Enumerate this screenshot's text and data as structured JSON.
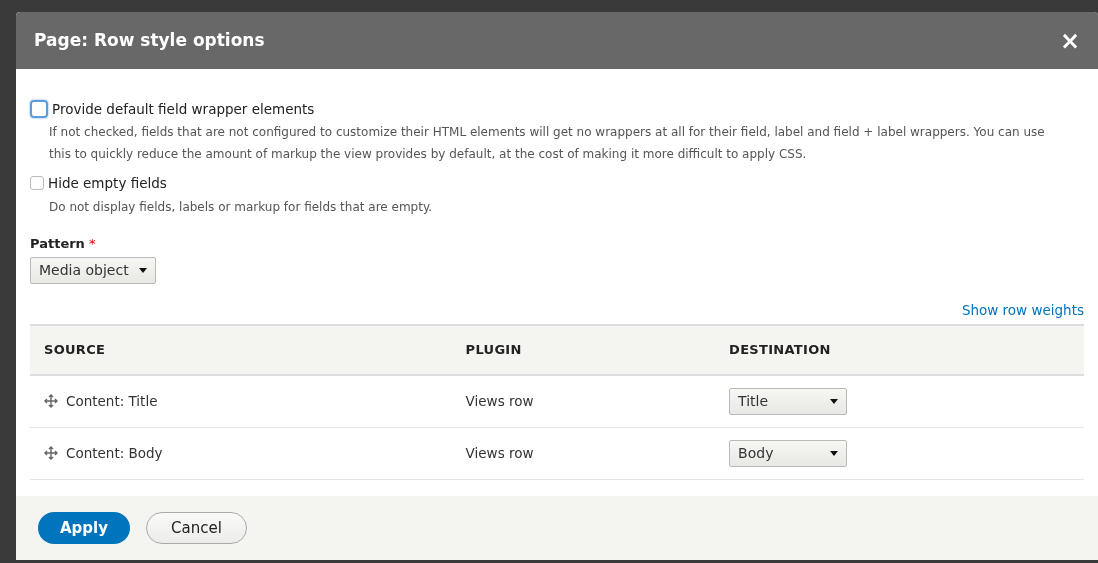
{
  "dialog": {
    "title": "Page: Row style options",
    "close": "×"
  },
  "options": [
    {
      "label": "Provide default field wrapper elements",
      "checked": false,
      "focused": true,
      "description": "If not checked, fields that are not configured to customize their HTML elements will get no wrappers at all for their field, label and field + label wrappers. You can use this to quickly reduce the amount of markup the view provides by default, at the cost of making it more difficult to apply CSS."
    },
    {
      "label": "Hide empty fields",
      "checked": false,
      "focused": false,
      "description": "Do not display fields, labels or markup for fields that are empty."
    }
  ],
  "pattern": {
    "label": "Pattern",
    "required_mark": "*",
    "value": "Media object"
  },
  "table": {
    "link": "Show row weights",
    "columns": [
      "SOURCE",
      "PLUGIN",
      "DESTINATION"
    ],
    "rows": [
      {
        "source": "Content: Title",
        "plugin": "Views row",
        "destination": "Title"
      },
      {
        "source": "Content: Body",
        "plugin": "Views row",
        "destination": "Body"
      }
    ]
  },
  "buttons": [
    {
      "label": "Apply",
      "kind": "primary"
    },
    {
      "label": "Cancel",
      "kind": "secondary"
    }
  ]
}
